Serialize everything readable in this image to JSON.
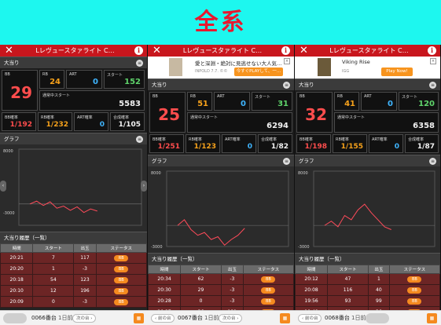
{
  "banner": {
    "title": "全系"
  },
  "panels": [
    {
      "header": {
        "title": "Lレヴュースタァライト C…",
        "close": "✕",
        "info": "i"
      },
      "bonus_title": "大当り",
      "stats": {
        "bb_label": "BB",
        "bb": "29",
        "rb_label": "RB",
        "rb": "24",
        "art_label": "ART",
        "art": "0",
        "start_label": "スタート",
        "start": "152",
        "tsujo_label": "通常中スタート",
        "tsujo": "5583",
        "bb_rate_label": "BB確率",
        "bb_rate": "1/192",
        "rb_rate_label": "RB確率",
        "rb_rate": "1/232",
        "art_rate_label": "ART確率",
        "art_rate": "0",
        "total_rate_label": "合成確率",
        "total_rate": "1/105"
      },
      "graph_title": "グラフ",
      "graph": {
        "ymax": "8000",
        "ymin": "-3000",
        "points": [
          [
            0,
            0
          ],
          [
            10,
            4
          ],
          [
            20,
            -2
          ],
          [
            30,
            3
          ],
          [
            40,
            -6
          ],
          [
            50,
            -3
          ],
          [
            60,
            -9
          ],
          [
            70,
            -4
          ],
          [
            80,
            -12
          ],
          [
            90,
            -7
          ],
          [
            100,
            -10
          ]
        ]
      },
      "history_title": "大当り履歴（一覧）",
      "table": {
        "headers": [
          "時間",
          "スタート",
          "出玉",
          "ステータス"
        ],
        "rows": [
          [
            "20:21",
            "7",
            "117",
            "RB"
          ],
          [
            "20:20",
            "1",
            "-3",
            "BB"
          ],
          [
            "20:18",
            "54",
            "123",
            "BB"
          ],
          [
            "20:10",
            "12",
            "196",
            "BB"
          ],
          [
            "20:09",
            "0",
            "-3",
            "BB"
          ]
        ]
      },
      "footer": {
        "prev": "",
        "machine": "0066番台",
        "day": "1日前",
        "next": "次の台 ›"
      }
    },
    {
      "header": {
        "title": "Lレヴュースタァライト C…",
        "close": "✕",
        "info": "i"
      },
      "ad": {
        "title": "愛と深淵・絶対に見逃せない大人気…",
        "sub": "INPOLD 7.7. ©©",
        "button": "今すぐPLAYして、一…"
      },
      "bonus_title": "大当り",
      "stats": {
        "bb_label": "BB",
        "bb": "25",
        "rb_label": "RB",
        "rb": "51",
        "art_label": "ART",
        "art": "0",
        "start_label": "スタート",
        "start": "31",
        "tsujo_label": "通常中スタート",
        "tsujo": "6294",
        "bb_rate_label": "BB確率",
        "bb_rate": "1/251",
        "rb_rate_label": "RB確率",
        "rb_rate": "1/123",
        "art_rate_label": "ART確率",
        "art_rate": "0",
        "total_rate_label": "合成確率",
        "total_rate": "1/82"
      },
      "graph_title": "グラフ",
      "graph": {
        "ymax": "8000",
        "ymin": "-3000",
        "points": [
          [
            0,
            0
          ],
          [
            10,
            8
          ],
          [
            20,
            -6
          ],
          [
            30,
            -14
          ],
          [
            40,
            -10
          ],
          [
            50,
            -20
          ],
          [
            60,
            -16
          ],
          [
            70,
            -28
          ],
          [
            80,
            -20
          ],
          [
            90,
            -14
          ],
          [
            100,
            -4
          ]
        ]
      },
      "history_title": "大当り履歴（一覧）",
      "table": {
        "headers": [
          "時間",
          "スタート",
          "出玉",
          "ステータス"
        ],
        "rows": [
          [
            "20:34",
            "62",
            "-3",
            "BB"
          ],
          [
            "20:30",
            "29",
            "-3",
            "BB"
          ],
          [
            "20:28",
            "0",
            "-3",
            "BB"
          ],
          [
            "20:27",
            "36",
            "121",
            "BB"
          ]
        ]
      },
      "footer": {
        "prev": "‹ 前の台",
        "machine": "0067番台",
        "day": "1日前",
        "next": "次の台 ›"
      }
    },
    {
      "header": {
        "title": "Lレヴュースタァライト C…",
        "close": "✕",
        "info": "i"
      },
      "ad": {
        "title": "Viking Rise",
        "sub": "IGG",
        "button": "Play Now!"
      },
      "bonus_title": "大当り",
      "stats": {
        "bb_label": "BB",
        "bb": "32",
        "rb_label": "RB",
        "rb": "41",
        "art_label": "ART",
        "art": "0",
        "start_label": "スタート",
        "start": "120",
        "tsujo_label": "通常中スタート",
        "tsujo": "6358",
        "bb_rate_label": "BB確率",
        "bb_rate": "1/198",
        "rb_rate_label": "RB確率",
        "rb_rate": "1/155",
        "art_rate_label": "ART確率",
        "art_rate": "0",
        "total_rate_label": "合成確率",
        "total_rate": "1/87"
      },
      "graph_title": "グラフ",
      "graph": {
        "ymax": "8000",
        "ymin": "-3000",
        "points": [
          [
            0,
            0
          ],
          [
            10,
            6
          ],
          [
            20,
            -2
          ],
          [
            30,
            14
          ],
          [
            40,
            8
          ],
          [
            50,
            22
          ],
          [
            60,
            30
          ],
          [
            70,
            18
          ],
          [
            80,
            8
          ],
          [
            90,
            -2
          ],
          [
            100,
            -6
          ]
        ]
      },
      "history_title": "大当り履歴（一覧）",
      "table": {
        "headers": [
          "時間",
          "スタート",
          "出玉",
          "ステータス"
        ],
        "rows": [
          [
            "20:12",
            "47",
            "1",
            "BB"
          ],
          [
            "20:08",
            "116",
            "40",
            "BB"
          ],
          [
            "19:56",
            "93",
            "99",
            "BB"
          ],
          [
            "19:48",
            "61",
            "36",
            "BB"
          ]
        ]
      },
      "footer": {
        "prev": "‹ 前の台",
        "machine": "0068番台",
        "day": "1日前",
        "next": ""
      }
    }
  ],
  "colors": {
    "banner_bg": "#1df7ef",
    "banner_text": "#e8182f",
    "header_red": "#c8161d",
    "bb_red": "#ff4d4d",
    "rb_orange": "#f7a21b",
    "art_blue": "#3fb5ff",
    "start_green": "#5fd36b",
    "graph_line": "#ff4b5a",
    "badge": "#f58a1f"
  }
}
